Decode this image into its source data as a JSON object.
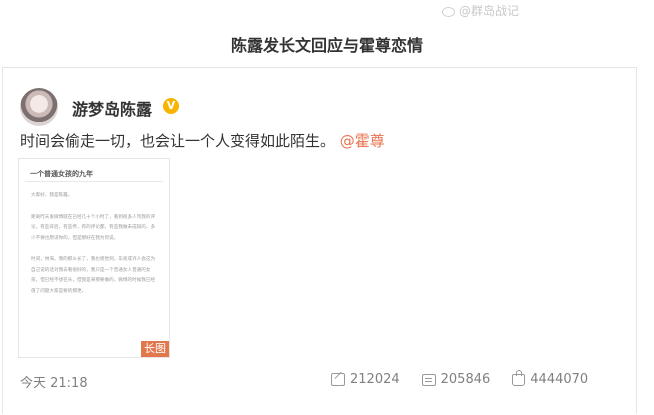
{
  "watermark": {
    "text": "@群岛战记"
  },
  "headline": "陈露发长文回应与霍尊恋情",
  "post": {
    "username": "游梦岛陈露",
    "verified_icon": "verified-badge-icon",
    "text": "时间会偷走一切，也会让一个人变得如此陌生。",
    "mention": "@霍尊",
    "long_image": {
      "title": "一个普通女孩的九年",
      "paragraphs": [
        "大家好，我是陈露。",
        "距离昨天发微博就在已经几十个小时了，看到很多人骂我的评论，有些背后，有些传，有的评论都，有些我做未成知的，多少不要也原谅你的，但是那好在我为何说。",
        "时间，林海，我的那么长了，我也感觉到，毕竟或许人会这为自己说的话对我去看很好的，我只是一个普通女人普通的女孩，但已经不想在头，但我是来那要做的，微博的时候我已经值了问题大家是要的那更。"
      ],
      "badge": "长图"
    },
    "time": "今天 21:18",
    "actions": [
      {
        "icon": "share-icon",
        "count": "212024"
      },
      {
        "icon": "comment-icon",
        "count": "205846"
      },
      {
        "icon": "like-icon",
        "count": "4444070"
      }
    ]
  }
}
